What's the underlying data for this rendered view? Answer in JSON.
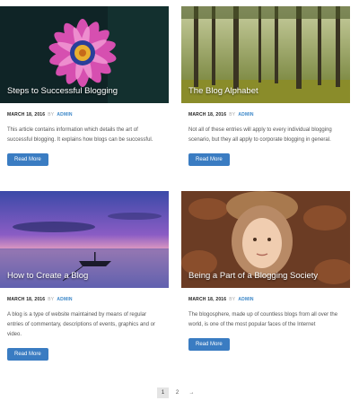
{
  "posts": [
    {
      "title": "Steps to Successful Blogging",
      "date": "MARCH 18, 2016",
      "by": "BY",
      "author": "ADMIN",
      "excerpt": "This article contains information which details the art of successful blogging. It explains how blogs can be successful.",
      "button": "Read More",
      "image": "purple-flower-image"
    },
    {
      "title": "The Blog Alphabet",
      "date": "MARCH 18, 2016",
      "by": "BY",
      "author": "ADMIN",
      "excerpt": "Not all of these entries will apply to every individual blogging scenario, but they all apply to corporate blogging in general.",
      "button": "Read More",
      "image": "forest-image"
    },
    {
      "title": "How to Create a Blog",
      "date": "MARCH 18, 2016",
      "by": "BY",
      "author": "ADMIN",
      "excerpt": "A blog is a type of website maintained by means of regular entries of commentary, descriptions of events, graphics and or video.",
      "button": "Read More",
      "image": "boat-sunset-image"
    },
    {
      "title": "Being a Part of a Blogging Society",
      "date": "MARCH 18, 2016",
      "by": "BY",
      "author": "ADMIN",
      "excerpt": "The blogosphere, made up of countless blogs from all over the world, is one of the most popular faces of the Internet",
      "button": "Read More",
      "image": "child-in-leaves-image"
    }
  ],
  "pagination": {
    "pages": [
      "1",
      "2"
    ],
    "current": "1",
    "next": "→"
  },
  "colors": {
    "accent": "#3a7cc2",
    "author_link": "#3a86c8"
  }
}
